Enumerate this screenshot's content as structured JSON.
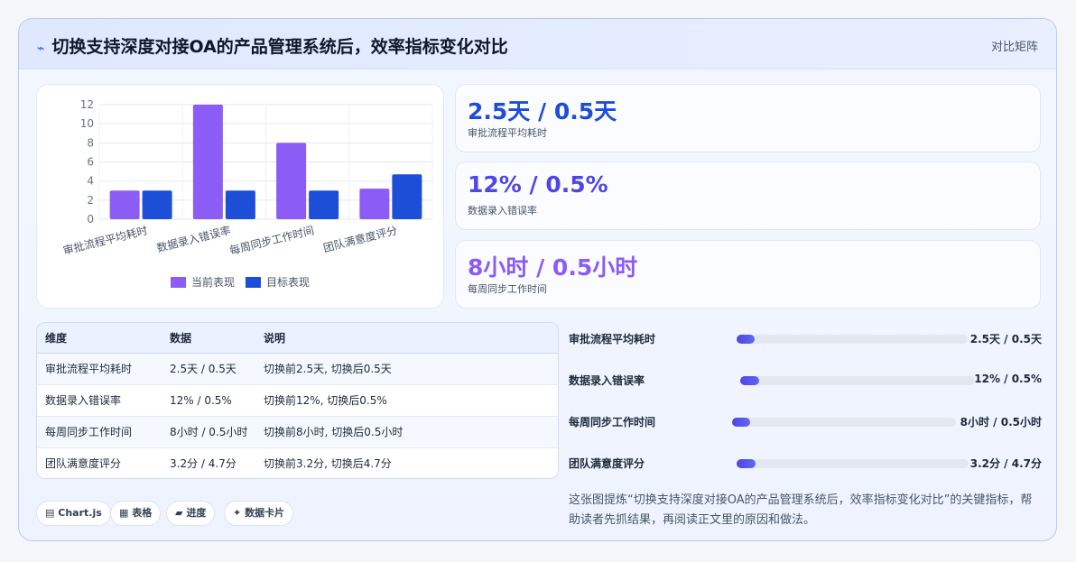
{
  "header": {
    "icon": "lightning-icon",
    "title": "切换支持深度对接OA的产品管理系统后，效率指标变化对比",
    "tag": "对比矩阵"
  },
  "colors": {
    "current": "#8b5cf6",
    "target": "#1d4ed8",
    "stat_blue": "#1d4ed8",
    "stat_indigo": "#4f46e5",
    "stat_purple": "#8b5cf6"
  },
  "chart_data": {
    "type": "bar",
    "categories": [
      "审批流程平均耗时",
      "数据录入错误率",
      "每周同步工作时间",
      "团队满意度评分"
    ],
    "series": [
      {
        "name": "当前表现",
        "values": [
          3.0,
          12,
          8,
          3.2
        ]
      },
      {
        "name": "目标表现",
        "values": [
          3.0,
          3.0,
          3.0,
          4.7
        ]
      }
    ],
    "ylim": [
      0,
      12
    ],
    "yticks": [
      "0",
      "2",
      "4",
      "6",
      "8",
      "10",
      "12"
    ],
    "grid": true,
    "legend": "bottom"
  },
  "stats": [
    {
      "value": "2.5天 / 0.5天",
      "label": "审批流程平均耗时"
    },
    {
      "value": "12% / 0.5%",
      "label": "数据录入错误率"
    },
    {
      "value": "8小时 / 0.5小时",
      "label": "每周同步工作时间"
    }
  ],
  "table": {
    "headers": [
      "维度",
      "数据",
      "说明"
    ],
    "rows": [
      [
        "审批流程平均耗时",
        "2.5天 / 0.5天",
        "切换前2.5天, 切换后0.5天"
      ],
      [
        "数据录入错误率",
        "12% / 0.5%",
        "切换前12%, 切换后0.5%"
      ],
      [
        "每周同步工作时间",
        "8小时 / 0.5小时",
        "切换前8小时, 切换后0.5小时"
      ],
      [
        "团队满意度评分",
        "3.2分 / 4.7分",
        "切换前3.2分, 切换后4.7分"
      ]
    ]
  },
  "progress": [
    {
      "label": "审批流程平均耗时",
      "value": "2.5天 / 0.5天",
      "fill": 0.08
    },
    {
      "label": "数据录入错误率",
      "value": "12% / 0.5%",
      "fill": 0.08
    },
    {
      "label": "每周同步工作时间",
      "value": "8小时 / 0.5小时",
      "fill": 0.08
    },
    {
      "label": "团队满意度评分",
      "value": "3.2分 / 4.7分",
      "fill": 0.08
    }
  ],
  "chips": [
    {
      "icon": "chart-icon",
      "glyph": "▤",
      "label": "Chart.js"
    },
    {
      "icon": "table-icon",
      "glyph": "▦",
      "label": "表格"
    },
    {
      "icon": "progress-icon",
      "glyph": "▰",
      "label": "进度"
    },
    {
      "icon": "sparkle-icon",
      "glyph": "✦",
      "label": "数据卡片"
    }
  ],
  "summary": "这张图提炼“切换支持深度对接OA的产品管理系统后，效率指标变化对比”的关键指标，帮助读者先抓结果，再阅读正文里的原因和做法。"
}
